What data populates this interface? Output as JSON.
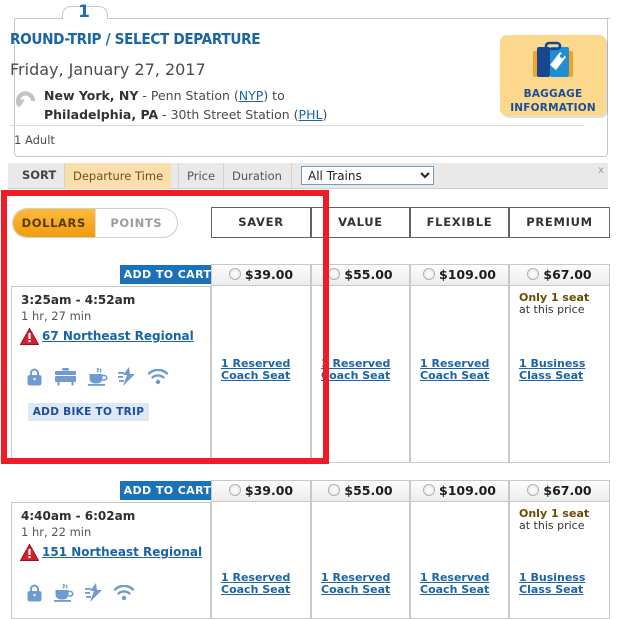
{
  "step": {
    "number": "1"
  },
  "header": {
    "title": "ROUND-TRIP / SELECT DEPARTURE",
    "date": "Friday, January 27, 2017",
    "origin_city": "New York, NY",
    "origin_station": " - Penn Station (",
    "origin_code": "NYP",
    "origin_tail": ") to",
    "dest_city": "Philadelphia, PA",
    "dest_station": " - 30th Street Station (",
    "dest_code": "PHL",
    "dest_tail": ")",
    "passengers": "1 Adult",
    "roundtrip_icon": "roundtrip-arrow-icon"
  },
  "baggage": {
    "icon": "suitcase-icon",
    "line1": "BAGGAGE",
    "line2": "INFORMATION"
  },
  "sortbar": {
    "label": "SORT",
    "options": [
      {
        "label": "Departure Time",
        "active": true
      },
      {
        "label": "Price",
        "active": false
      },
      {
        "label": "Duration",
        "active": false
      }
    ],
    "filter_value": "All Trains",
    "filter_options": [
      "All Trains"
    ],
    "close_label": "x"
  },
  "currency_toggle": {
    "dollars": "DOLLARS",
    "points": "POINTS",
    "selected": "DOLLARS"
  },
  "fare_classes": [
    "SAVER",
    "VALUE",
    "FLEXIBLE",
    "PREMIUM"
  ],
  "labels": {
    "add_to_cart": "ADD TO CART",
    "add_bike": "ADD BIKE TO TRIP",
    "only_one_seat_bold": "Only 1 seat",
    "only_one_seat_rest": "at this price"
  },
  "trips": [
    {
      "times": "3:25am - 4:52am",
      "duration": "1 hr, 27 min",
      "alert_icon": "warning-triangle-icon",
      "train": "67 Northeast Regional",
      "amenities": [
        "carry-on-bag-icon",
        "checked-baggage-icon",
        "cafe-coffee-icon",
        "power-outlet-icon",
        "wifi-icon"
      ],
      "has_bike_button": true,
      "fares": [
        {
          "class": "SAVER",
          "price": "$39.00",
          "seat": "1 Reserved\nCoach Seat",
          "note": null
        },
        {
          "class": "VALUE",
          "price": "$55.00",
          "seat": "1 Reserved\nCoach Seat",
          "note": null
        },
        {
          "class": "FLEXIBLE",
          "price": "$109.00",
          "seat": "1 Reserved\nCoach Seat",
          "note": null
        },
        {
          "class": "PREMIUM",
          "price": "$67.00",
          "seat": "1 Business\nClass Seat",
          "note": "Only 1 seat at this price"
        }
      ]
    },
    {
      "times": "4:40am - 6:02am",
      "duration": "1 hr, 22 min",
      "alert_icon": "warning-triangle-icon",
      "train": "151 Northeast Regional",
      "amenities": [
        "carry-on-bag-icon",
        "cafe-coffee-icon",
        "power-outlet-icon",
        "wifi-icon"
      ],
      "has_bike_button": false,
      "fares": [
        {
          "class": "SAVER",
          "price": "$39.00",
          "seat": "1 Reserved\nCoach Seat",
          "note": null
        },
        {
          "class": "VALUE",
          "price": "$55.00",
          "seat": "1 Reserved\nCoach Seat",
          "note": null
        },
        {
          "class": "FLEXIBLE",
          "price": "$109.00",
          "seat": "1 Reserved\nCoach Seat",
          "note": null
        },
        {
          "class": "PREMIUM",
          "price": "$67.00",
          "seat": "1 Business\nClass Seat",
          "note": "Only 1 seat at this price"
        }
      ]
    }
  ],
  "highlight": {
    "color": "#ee1c25"
  },
  "colors": {
    "brand_blue": "#1b64a5",
    "accent_orange": "#f39b10",
    "cart_blue": "#1c72b8",
    "baggage_bg": "#fbd88b"
  }
}
